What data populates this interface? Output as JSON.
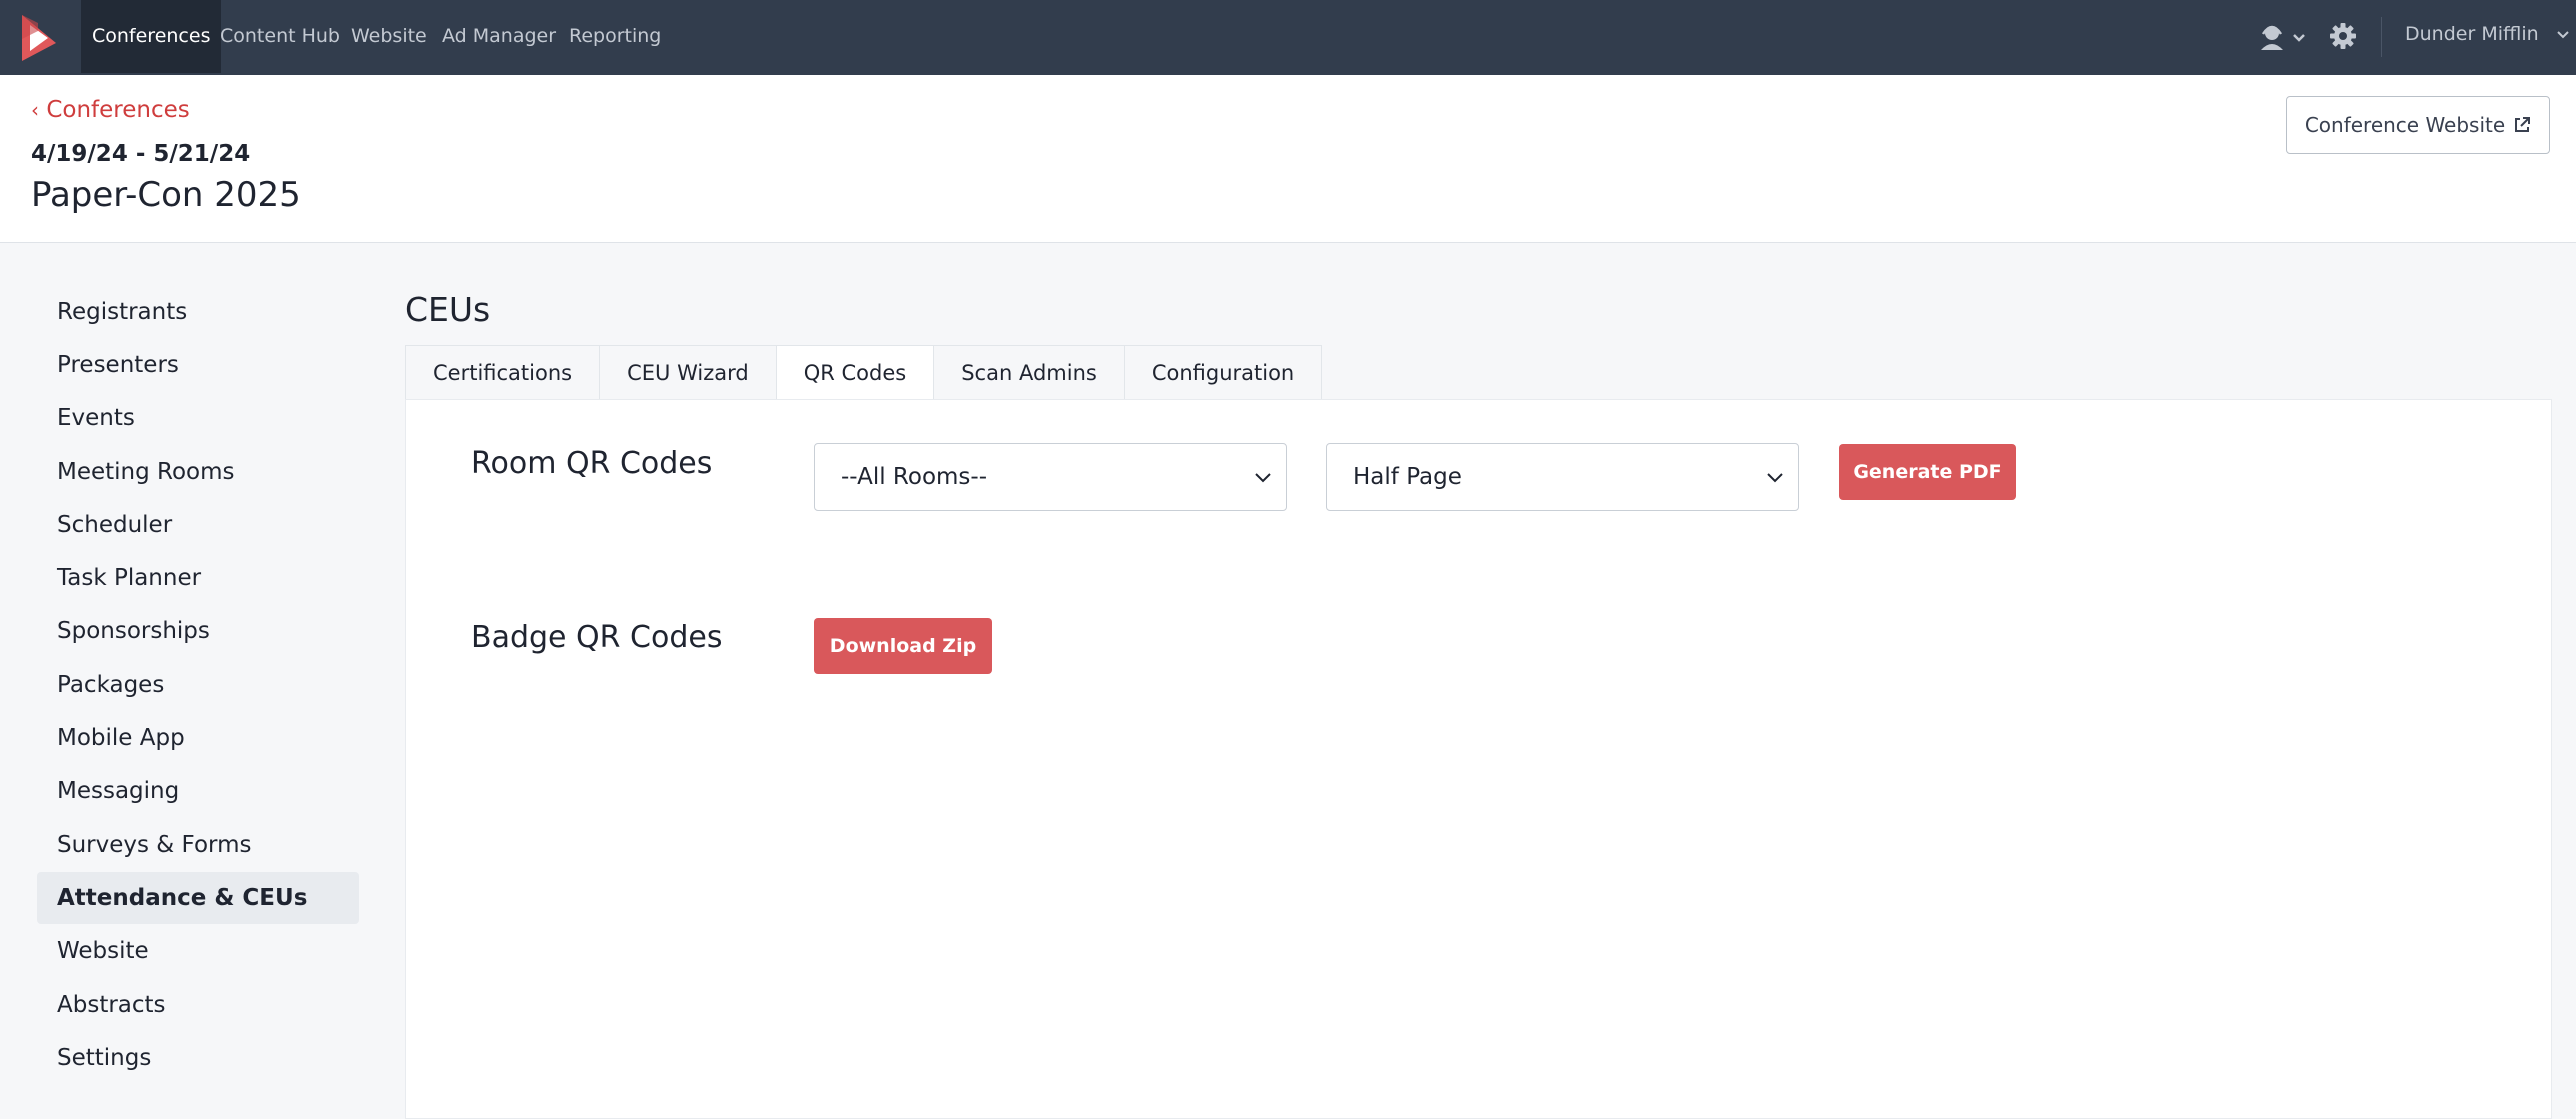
{
  "topnav": {
    "items": [
      "Conferences",
      "Content Hub",
      "Website",
      "Ad Manager",
      "Reporting"
    ],
    "active_index": 0,
    "account_name": "Dunder Mifflin",
    "icons": [
      "logo-icon",
      "user-headset-icon",
      "chevron-down-icon",
      "gear-icon"
    ]
  },
  "header": {
    "back_label": "Conferences",
    "dates": "4/19/24 - 5/21/24",
    "title": "Paper-Con 2025",
    "website_button": "Conference Website"
  },
  "sidebar": {
    "items": [
      "Registrants",
      "Presenters",
      "Events",
      "Meeting Rooms",
      "Scheduler",
      "Task Planner",
      "Sponsorships",
      "Packages",
      "Mobile App",
      "Messaging",
      "Surveys & Forms",
      "Attendance & CEUs",
      "Website",
      "Abstracts",
      "Settings"
    ],
    "active_index": 11
  },
  "main": {
    "section_title": "CEUs",
    "tabs": [
      "Certifications",
      "CEU Wizard",
      "QR Codes",
      "Scan Admins",
      "Configuration"
    ],
    "active_tab_index": 2,
    "room_qr": {
      "label": "Room QR Codes",
      "room_select_value": "--All Rooms--",
      "size_select_value": "Half Page",
      "button": "Generate PDF"
    },
    "badge_qr": {
      "label": "Badge QR Codes",
      "button": "Download Zip"
    }
  },
  "colors": {
    "nav_bg": "#323d4d",
    "accent_red": "#d9585b",
    "link_red": "#cf3d3d"
  }
}
